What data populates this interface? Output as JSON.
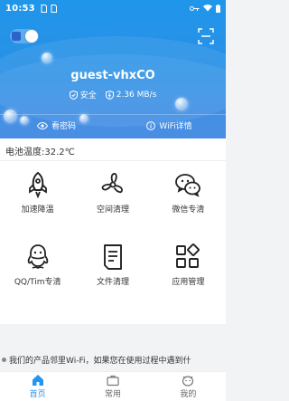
{
  "status_bar": {
    "time": "10:53"
  },
  "wifi": {
    "ssid": "guest-vhxCO",
    "security": "安全",
    "speed": "2.36 MB/s"
  },
  "actions": {
    "view_password": "看密码",
    "wifi_details": "WiFi详情"
  },
  "battery": {
    "temperature_label": "电池温度:32.2℃"
  },
  "tools": [
    {
      "label": "加速降温",
      "icon": "rocket-icon"
    },
    {
      "label": "空间清理",
      "icon": "fan-icon"
    },
    {
      "label": "微信专清",
      "icon": "wechat-icon"
    },
    {
      "label": "QQ/Tim专清",
      "icon": "qq-icon"
    },
    {
      "label": "文件清理",
      "icon": "file-icon"
    },
    {
      "label": "应用管理",
      "icon": "apps-icon"
    }
  ],
  "notice": {
    "text": "我们的产品邻里Wi-Fi，如果您在使用过程中遇到什"
  },
  "tabs": [
    {
      "label": "首页",
      "active": true,
      "icon": "home-icon"
    },
    {
      "label": "常用",
      "active": false,
      "icon": "briefcase-icon"
    },
    {
      "label": "我的",
      "active": false,
      "icon": "profile-icon"
    }
  ],
  "colors": {
    "primary": "#2196f3",
    "hero_top": "#1f96ea",
    "hero_bottom": "#3f87e2"
  }
}
